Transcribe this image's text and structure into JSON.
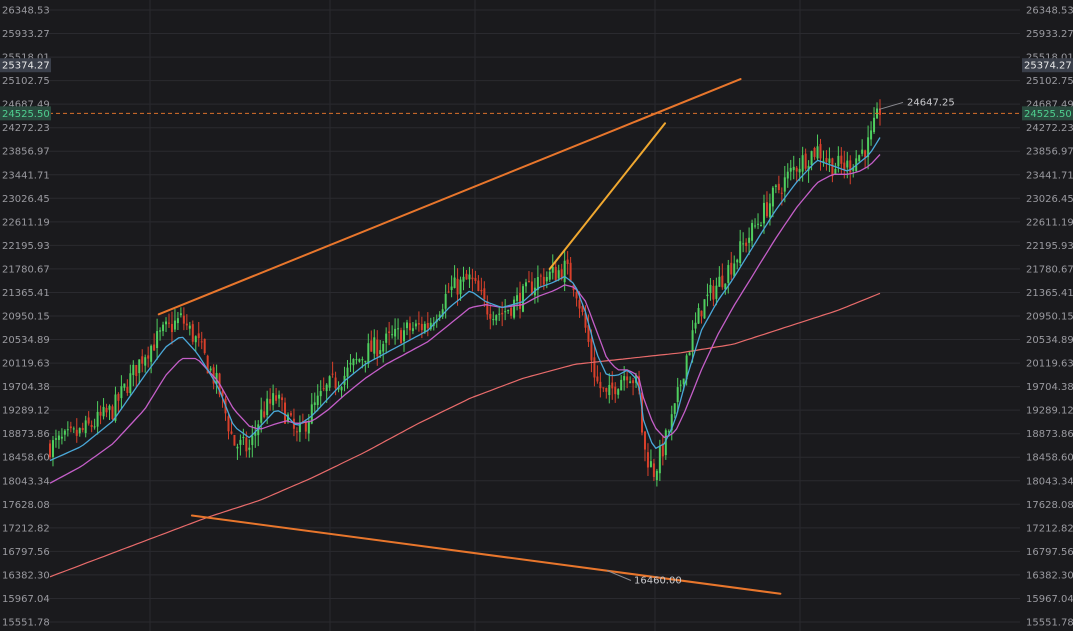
{
  "chart_data": {
    "type": "candlestick",
    "y_ticks": [
      "26348.53",
      "25933.27",
      "25518.01",
      "25102.75",
      "24687.49",
      "24272.23",
      "23856.97",
      "23441.71",
      "23026.45",
      "22611.19",
      "22195.93",
      "21780.67",
      "21365.41",
      "20950.15",
      "20534.89",
      "20119.63",
      "19704.38",
      "19289.12",
      "18873.86",
      "18458.60",
      "18043.34",
      "17628.08",
      "17212.82",
      "16797.56",
      "16382.30",
      "15967.04",
      "15551.78"
    ],
    "ylim": [
      15551.78,
      26348.53
    ],
    "grid": true,
    "price_tags": [
      {
        "label": "25374.27",
        "value": 25374.27,
        "color": "#3a3f4a",
        "text_color": "#e8e8e8"
      },
      {
        "label": "24525.50",
        "value": 24525.5,
        "color": "#2a4a3e",
        "text_color": "#4fcf8f"
      }
    ],
    "annotations": [
      {
        "label": "24647.25",
        "value": 24647.25
      },
      {
        "label": "16460.00",
        "value": 16460.0
      }
    ],
    "trendlines": [
      {
        "name": "upper",
        "color": "#e8762c",
        "points": [
          [
            0.131,
            20980
          ],
          [
            0.832,
            25130
          ]
        ]
      },
      {
        "name": "lower",
        "color": "#e8762c",
        "points": [
          [
            0.171,
            17430
          ],
          [
            0.88,
            16050
          ]
        ]
      },
      {
        "name": "short",
        "color": "#f0a830",
        "points": [
          [
            0.602,
            21780
          ],
          [
            0.741,
            24350
          ]
        ]
      }
    ],
    "close_path": [
      [
        0.0,
        18650
      ],
      [
        0.03,
        18900
      ],
      [
        0.06,
        19300
      ],
      [
        0.09,
        20300
      ],
      [
        0.11,
        20700
      ],
      [
        0.125,
        20900
      ],
      [
        0.14,
        20500
      ],
      [
        0.16,
        19700
      ],
      [
        0.175,
        18700
      ],
      [
        0.19,
        18600
      ],
      [
        0.2,
        19200
      ],
      [
        0.215,
        19500
      ],
      [
        0.225,
        19200
      ],
      [
        0.235,
        18800
      ],
      [
        0.25,
        19300
      ],
      [
        0.265,
        19700
      ],
      [
        0.28,
        19900
      ],
      [
        0.3,
        20300
      ],
      [
        0.32,
        20500
      ],
      [
        0.34,
        20700
      ],
      [
        0.36,
        20800
      ],
      [
        0.38,
        21400
      ],
      [
        0.4,
        21600
      ],
      [
        0.415,
        21100
      ],
      [
        0.43,
        21000
      ],
      [
        0.45,
        21300
      ],
      [
        0.465,
        21600
      ],
      [
        0.48,
        21700
      ],
      [
        0.49,
        21800
      ],
      [
        0.5,
        21500
      ],
      [
        0.51,
        20700
      ],
      [
        0.52,
        19800
      ],
      [
        0.53,
        19500
      ],
      [
        0.54,
        19800
      ],
      [
        0.55,
        20000
      ],
      [
        0.56,
        19700
      ],
      [
        0.565,
        18600
      ],
      [
        0.575,
        18200
      ],
      [
        0.585,
        18700
      ],
      [
        0.595,
        19300
      ],
      [
        0.605,
        20200
      ],
      [
        0.62,
        21100
      ],
      [
        0.635,
        21500
      ],
      [
        0.65,
        21900
      ],
      [
        0.67,
        22500
      ],
      [
        0.69,
        23100
      ],
      [
        0.71,
        23600
      ],
      [
        0.73,
        23900
      ],
      [
        0.745,
        23600
      ],
      [
        0.76,
        23600
      ],
      [
        0.77,
        23800
      ],
      [
        0.78,
        24000
      ],
      [
        0.79,
        24600
      ]
    ],
    "sma_fast": [
      [
        0.0,
        18400
      ],
      [
        0.03,
        18650
      ],
      [
        0.06,
        19100
      ],
      [
        0.09,
        19900
      ],
      [
        0.11,
        20400
      ],
      [
        0.125,
        20600
      ],
      [
        0.14,
        20300
      ],
      [
        0.16,
        19700
      ],
      [
        0.175,
        19000
      ],
      [
        0.19,
        18800
      ],
      [
        0.2,
        19000
      ],
      [
        0.215,
        19300
      ],
      [
        0.225,
        19200
      ],
      [
        0.235,
        19000
      ],
      [
        0.25,
        19200
      ],
      [
        0.265,
        19500
      ],
      [
        0.28,
        19800
      ],
      [
        0.3,
        20100
      ],
      [
        0.32,
        20300
      ],
      [
        0.34,
        20500
      ],
      [
        0.36,
        20700
      ],
      [
        0.38,
        21100
      ],
      [
        0.4,
        21400
      ],
      [
        0.415,
        21200
      ],
      [
        0.43,
        21100
      ],
      [
        0.45,
        21200
      ],
      [
        0.465,
        21450
      ],
      [
        0.48,
        21550
      ],
      [
        0.49,
        21650
      ],
      [
        0.5,
        21500
      ],
      [
        0.51,
        21000
      ],
      [
        0.52,
        20300
      ],
      [
        0.53,
        19900
      ],
      [
        0.54,
        19900
      ],
      [
        0.55,
        20000
      ],
      [
        0.56,
        19800
      ],
      [
        0.565,
        19100
      ],
      [
        0.575,
        18600
      ],
      [
        0.585,
        18700
      ],
      [
        0.595,
        19100
      ],
      [
        0.605,
        19800
      ],
      [
        0.62,
        20700
      ],
      [
        0.635,
        21200
      ],
      [
        0.65,
        21600
      ],
      [
        0.67,
        22200
      ],
      [
        0.69,
        22800
      ],
      [
        0.71,
        23300
      ],
      [
        0.73,
        23700
      ],
      [
        0.745,
        23600
      ],
      [
        0.76,
        23500
      ],
      [
        0.77,
        23650
      ],
      [
        0.78,
        23800
      ],
      [
        0.79,
        24100
      ]
    ],
    "sma_slow": [
      [
        0.0,
        18000
      ],
      [
        0.03,
        18300
      ],
      [
        0.06,
        18700
      ],
      [
        0.09,
        19300
      ],
      [
        0.11,
        19900
      ],
      [
        0.125,
        20200
      ],
      [
        0.14,
        20200
      ],
      [
        0.16,
        19800
      ],
      [
        0.175,
        19300
      ],
      [
        0.19,
        19000
      ],
      [
        0.2,
        18950
      ],
      [
        0.215,
        19050
      ],
      [
        0.225,
        19100
      ],
      [
        0.235,
        19050
      ],
      [
        0.25,
        19100
      ],
      [
        0.265,
        19300
      ],
      [
        0.28,
        19550
      ],
      [
        0.3,
        19850
      ],
      [
        0.32,
        20100
      ],
      [
        0.34,
        20300
      ],
      [
        0.36,
        20500
      ],
      [
        0.38,
        20800
      ],
      [
        0.4,
        21100
      ],
      [
        0.415,
        21150
      ],
      [
        0.43,
        21100
      ],
      [
        0.45,
        21150
      ],
      [
        0.465,
        21300
      ],
      [
        0.48,
        21400
      ],
      [
        0.49,
        21500
      ],
      [
        0.5,
        21450
      ],
      [
        0.51,
        21200
      ],
      [
        0.52,
        20700
      ],
      [
        0.53,
        20200
      ],
      [
        0.54,
        20000
      ],
      [
        0.55,
        20000
      ],
      [
        0.56,
        19900
      ],
      [
        0.565,
        19500
      ],
      [
        0.575,
        19000
      ],
      [
        0.585,
        18800
      ],
      [
        0.595,
        18900
      ],
      [
        0.605,
        19300
      ],
      [
        0.62,
        20000
      ],
      [
        0.635,
        20600
      ],
      [
        0.65,
        21100
      ],
      [
        0.67,
        21700
      ],
      [
        0.69,
        22300
      ],
      [
        0.71,
        22850
      ],
      [
        0.73,
        23300
      ],
      [
        0.745,
        23450
      ],
      [
        0.76,
        23450
      ],
      [
        0.77,
        23500
      ],
      [
        0.78,
        23600
      ],
      [
        0.79,
        23800
      ]
    ],
    "sma_long": [
      [
        0.0,
        16350
      ],
      [
        0.05,
        16700
      ],
      [
        0.1,
        17050
      ],
      [
        0.15,
        17400
      ],
      [
        0.2,
        17700
      ],
      [
        0.25,
        18100
      ],
      [
        0.3,
        18550
      ],
      [
        0.35,
        19050
      ],
      [
        0.4,
        19500
      ],
      [
        0.45,
        19850
      ],
      [
        0.5,
        20100
      ],
      [
        0.55,
        20200
      ],
      [
        0.6,
        20300
      ],
      [
        0.65,
        20450
      ],
      [
        0.7,
        20750
      ],
      [
        0.75,
        21050
      ],
      [
        0.79,
        21350
      ]
    ],
    "colors": {
      "background": "#1a1a1d",
      "grid": "#2a2a2f",
      "up": "#4fcf5f",
      "down": "#d9402b",
      "sma_fast": "#4aa8d8",
      "sma_slow": "#c45ec8",
      "sma_long": "#e86b6b"
    }
  }
}
